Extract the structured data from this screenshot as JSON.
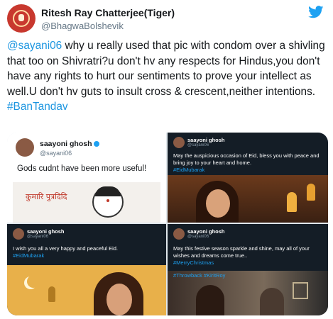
{
  "tweet": {
    "name": "Ritesh Ray Chatterjee(Tiger)",
    "handle": "@BhagwaBolshevik",
    "text_mention": "@sayani06",
    "text_body": " why u really used that pic with condom over a shivling that too on Shivratri?u don't hv any respects for Hindus,you don't have any rights to hurt our sentiments to prove your intellect as well.U don't hv guts to insult cross & crescent,neither intentions.",
    "hashtag": "#BanTandav"
  },
  "media": {
    "panel1": {
      "name": "saayoni ghosh",
      "handle": "@sayani06",
      "text": "Gods cudnt have been more useful!",
      "sketch_text": "कुमारि पुत्रदिदि"
    },
    "panel2": {
      "name": "saayoni ghosh",
      "handle": "@sayani06",
      "text": "May the auspicious occasion of Eid, bless you with peace and bring joy to your heart and home.",
      "tag": "#EidMubarak"
    },
    "panel3": {
      "name": "saayoni ghosh",
      "handle": "@sayani06",
      "text": "I wish you all a very happy and peaceful Eid.",
      "tag": "#EidMubarak"
    },
    "panel4": {
      "name": "saayoni ghosh",
      "handle": "@sayani06",
      "text": "May this festive season sparkle and shine, may all of your wishes and dreams come true..",
      "tag1": "#MerryChristmas",
      "tag2": "#Throwback #KiritRoy"
    }
  },
  "colors": {
    "link": "#1b95e0",
    "twitter_blue": "#1da1f2",
    "dark_panel": "#141d26"
  },
  "icons": [
    "avatar-emblem",
    "twitter-bird-icon",
    "verified-icon"
  ]
}
